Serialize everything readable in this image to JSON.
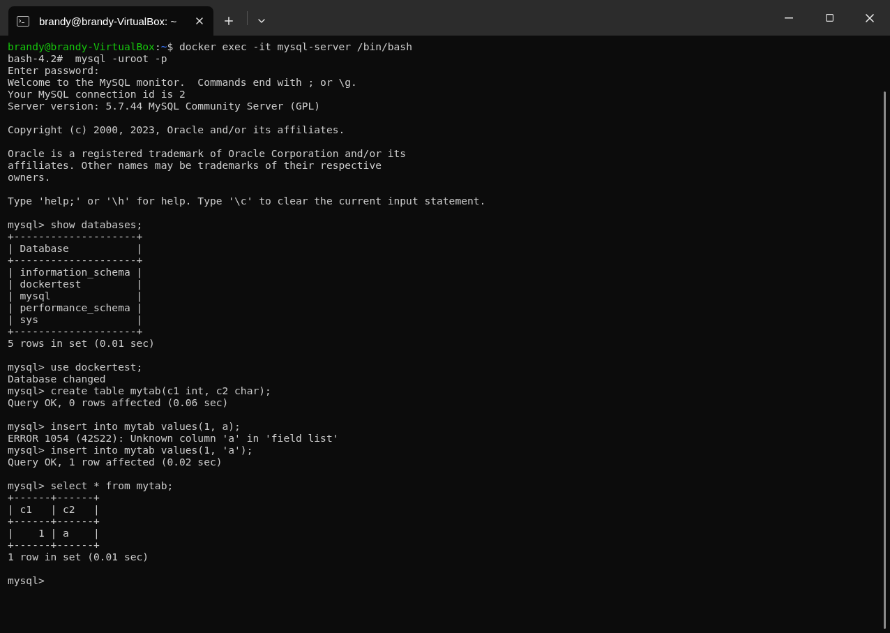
{
  "window": {
    "tab": {
      "title": "brandy@brandy-VirtualBox: ~",
      "selected": true
    }
  },
  "lines": [
    {
      "kind": "prompt",
      "segments": [
        {
          "text": "brandy@brandy-VirtualBox",
          "color": "#16c60c"
        },
        {
          "text": ":",
          "color": "#cccccc"
        },
        {
          "text": "~",
          "color": "#3b78ff"
        },
        {
          "text": "$ docker exec -it mysql-server /bin/bash",
          "color": "#cccccc"
        }
      ]
    },
    {
      "kind": "output",
      "text": "bash-4.2#  mysql -uroot -p"
    },
    {
      "kind": "output",
      "text": "Enter password:"
    },
    {
      "kind": "output",
      "text": "Welcome to the MySQL monitor.  Commands end with ; or \\g."
    },
    {
      "kind": "output",
      "text": "Your MySQL connection id is 2"
    },
    {
      "kind": "output",
      "text": "Server version: 5.7.44 MySQL Community Server (GPL)"
    },
    {
      "kind": "blank"
    },
    {
      "kind": "output",
      "text": "Copyright (c) 2000, 2023, Oracle and/or its affiliates."
    },
    {
      "kind": "blank"
    },
    {
      "kind": "output",
      "text": "Oracle is a registered trademark of Oracle Corporation and/or its"
    },
    {
      "kind": "output",
      "text": "affiliates. Other names may be trademarks of their respective"
    },
    {
      "kind": "output",
      "text": "owners."
    },
    {
      "kind": "blank"
    },
    {
      "kind": "output",
      "text": "Type 'help;' or '\\h' for help. Type '\\c' to clear the current input statement."
    },
    {
      "kind": "blank"
    },
    {
      "kind": "output",
      "text": "mysql> show databases;"
    },
    {
      "kind": "output",
      "text": "+--------------------+"
    },
    {
      "kind": "output",
      "text": "| Database           |"
    },
    {
      "kind": "output",
      "text": "+--------------------+"
    },
    {
      "kind": "output",
      "text": "| information_schema |"
    },
    {
      "kind": "output",
      "text": "| dockertest         |"
    },
    {
      "kind": "output",
      "text": "| mysql              |"
    },
    {
      "kind": "output",
      "text": "| performance_schema |"
    },
    {
      "kind": "output",
      "text": "| sys                |"
    },
    {
      "kind": "output",
      "text": "+--------------------+"
    },
    {
      "kind": "output",
      "text": "5 rows in set (0.01 sec)"
    },
    {
      "kind": "blank"
    },
    {
      "kind": "output",
      "text": "mysql> use dockertest;"
    },
    {
      "kind": "output",
      "text": "Database changed"
    },
    {
      "kind": "output",
      "text": "mysql> create table mytab(c1 int, c2 char);"
    },
    {
      "kind": "output",
      "text": "Query OK, 0 rows affected (0.06 sec)"
    },
    {
      "kind": "blank"
    },
    {
      "kind": "output",
      "text": "mysql> insert into mytab values(1, a);"
    },
    {
      "kind": "output",
      "text": "ERROR 1054 (42S22): Unknown column 'a' in 'field list'"
    },
    {
      "kind": "output",
      "text": "mysql> insert into mytab values(1, 'a');"
    },
    {
      "kind": "output",
      "text": "Query OK, 1 row affected (0.02 sec)"
    },
    {
      "kind": "blank"
    },
    {
      "kind": "output",
      "text": "mysql> select * from mytab;"
    },
    {
      "kind": "output",
      "text": "+------+------+"
    },
    {
      "kind": "output",
      "text": "| c1   | c2   |"
    },
    {
      "kind": "output",
      "text": "+------+------+"
    },
    {
      "kind": "output",
      "text": "|    1 | a    |"
    },
    {
      "kind": "output",
      "text": "+------+------+"
    },
    {
      "kind": "output",
      "text": "1 row in set (0.01 sec)"
    },
    {
      "kind": "blank"
    },
    {
      "kind": "output",
      "text": "mysql>"
    }
  ]
}
